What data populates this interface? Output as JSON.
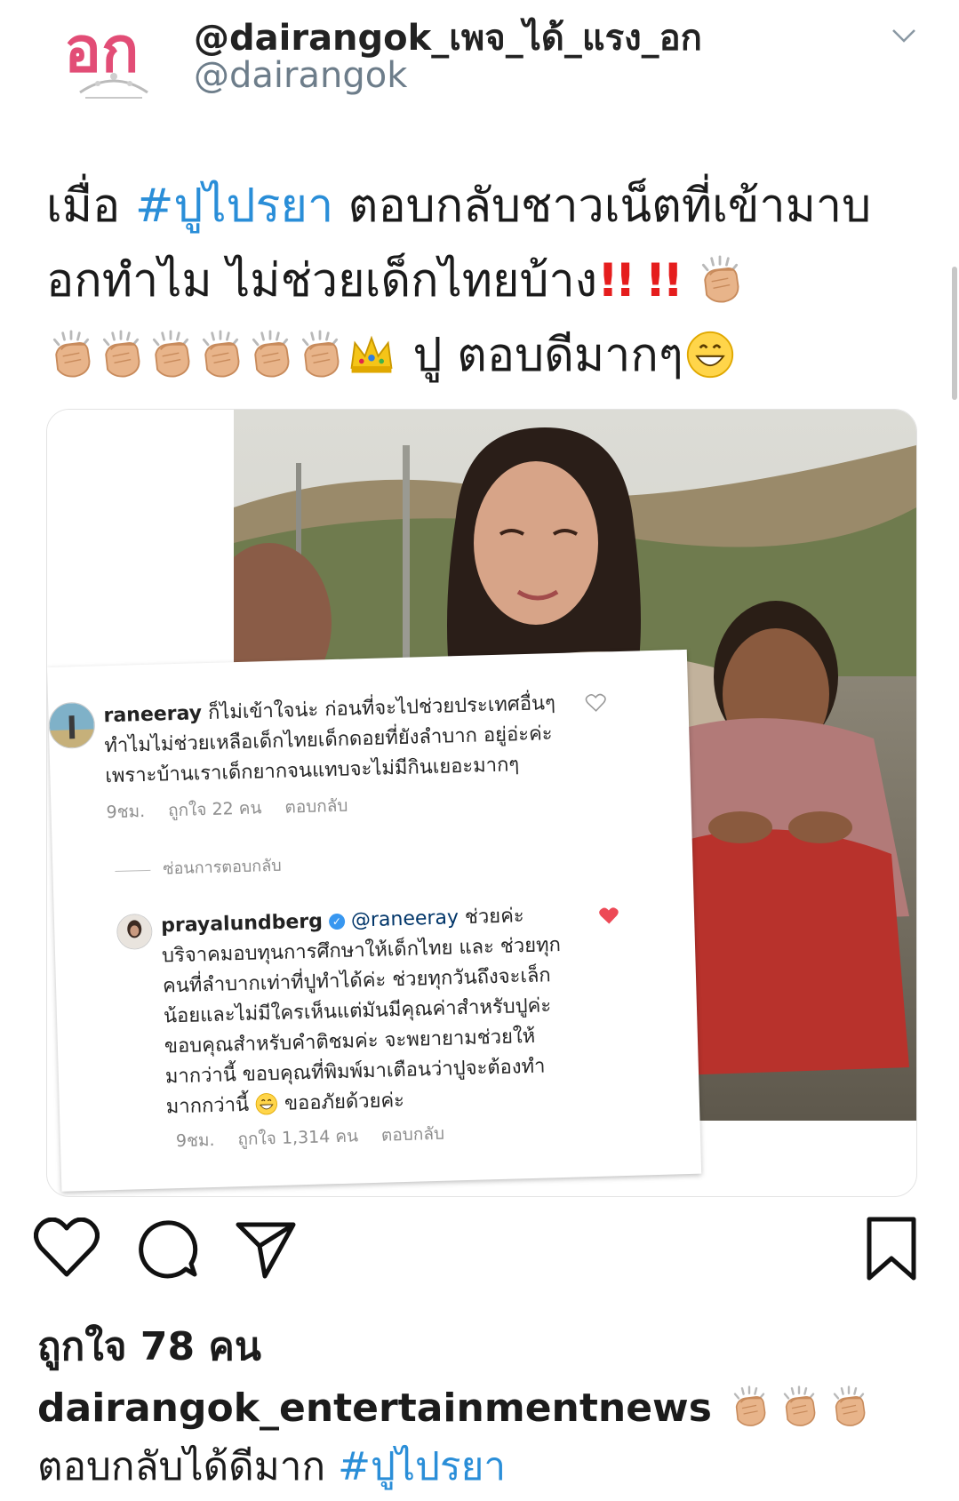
{
  "header": {
    "logo_text": "อก",
    "display_name": "@dairangok_เพจ_ได้_แรง_อก",
    "handle": "@dairangok"
  },
  "tweet": {
    "part1": "เมื่อ ",
    "hashtag": "#ปูไปรยา",
    "part2": " ตอบกลับชาวเน็ตที่เข้ามาบอกทำไม ไม่ช่วยเด็กไทยบ้าง",
    "bangs": "!! !!",
    "part3": " ปู ตอบดีมากๆ"
  },
  "comments": {
    "c1": {
      "user": "raneeray",
      "text": " ก็ไม่เข้าใจน่ะ ก่อนที่จะไปช่วยประเทศอื่นๆ ทำไมไม่ช่วยเหลือเด็กไทยเด็กดอยที่ยังลำบาก อยู่อ่ะค่ะ เพราะบ้านเราเด็กยากจนแทบจะไม่มีกินเยอะมากๆ",
      "time": "9ชม.",
      "likes": "ถูกใจ 22 คน",
      "reply": "ตอบกลับ"
    },
    "hide_replies": "ซ่อนการตอบกลับ",
    "c2": {
      "user": "prayalundberg",
      "mention": "@raneeray",
      "text": " ช่วยค่ะ บริจาคมอบทุนการศึกษาให้เด็กไทย และ ช่วยทุกคนที่ลำบากเท่าที่ปูทำได้ค่ะ ช่วยทุกวันถึงจะเล็กน้อยและไม่มีใครเห็นแต่มันมีคุณค่าสำหรับปูค่ะ ขอบคุณสำหรับคำติชมค่ะ จะพยายามช่วยให้มากว่านี้ ขอบคุณที่พิมพ์มาเตือนว่าปูจะต้องทำมากกว่านี้ ",
      "text_end": " ขออภัยด้วยค่ะ",
      "time": "9ชม.",
      "likes": "ถูกใจ 1,314 คน",
      "reply": "ตอบกลับ"
    }
  },
  "post": {
    "likes": "ถูกใจ 78 คน",
    "caption_user": "dairangok_entertainmentnews",
    "caption_text": " ตอบกลับได้ดีมาก ",
    "caption_hashtag": "#ปูไปรยา"
  },
  "colors": {
    "hashtag": "#2a8ed8",
    "handle": "#6d7d8a",
    "logo": "#e24d76",
    "bang": "#e51d1d",
    "heart_liked": "#ed4956"
  },
  "icons": [
    "chevron-down-icon",
    "clapping-hands-emoji",
    "crown-emoji",
    "grinning-emoji",
    "heart-icon",
    "comment-icon",
    "share-icon",
    "bookmark-icon",
    "verified-icon",
    "smile-emoji"
  ]
}
